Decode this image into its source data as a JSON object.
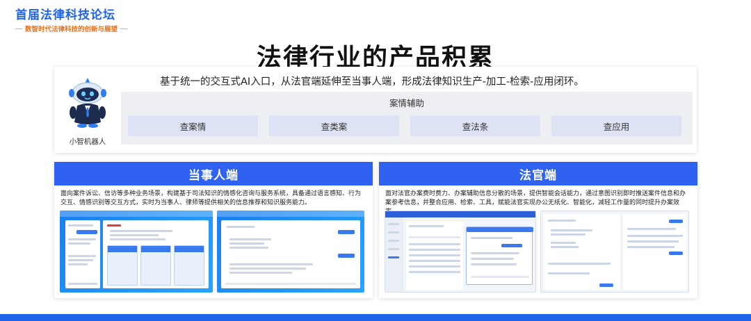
{
  "brand": {
    "title": "首届法律科技论坛",
    "subtitle": "数智时代法律科技的创新与展望"
  },
  "main_title": "法律行业的产品积累",
  "top_panel": {
    "description": "基于统一的交互式AI入口，从法官端延伸至当事人端，形成法律知识生产-加工-检索-应用闭环。",
    "robot_label": "小智机器人",
    "assist_title": "案情辅助",
    "buttons": [
      "查案情",
      "查类案",
      "查法条",
      "查应用"
    ]
  },
  "cards": {
    "party": {
      "title": "当事人端",
      "description": "面向案件诉讼、信访等多种业务场景，构建基于司法知识的情感化咨询与服务系统，具备通过语言感知、行为交互、情感识别等交互方式，实时为当事人、律师等提供相关的信息推荐和知识服务能力。"
    },
    "judge": {
      "title": "法官端",
      "description": "面对法官办案费时费力、办案辅助信息分散的场景，提供智能会话能力，通过意图识别即时推送案件信息和办案参考信息，并整合应用、检索、工具，赋能法官实现办公无纸化、智能化，减轻工作量的同时提升办案效率。"
    }
  },
  "colors": {
    "accent": "#2f62f0",
    "brand_blue": "#1f63e8",
    "brand_orange": "#e8731f"
  }
}
